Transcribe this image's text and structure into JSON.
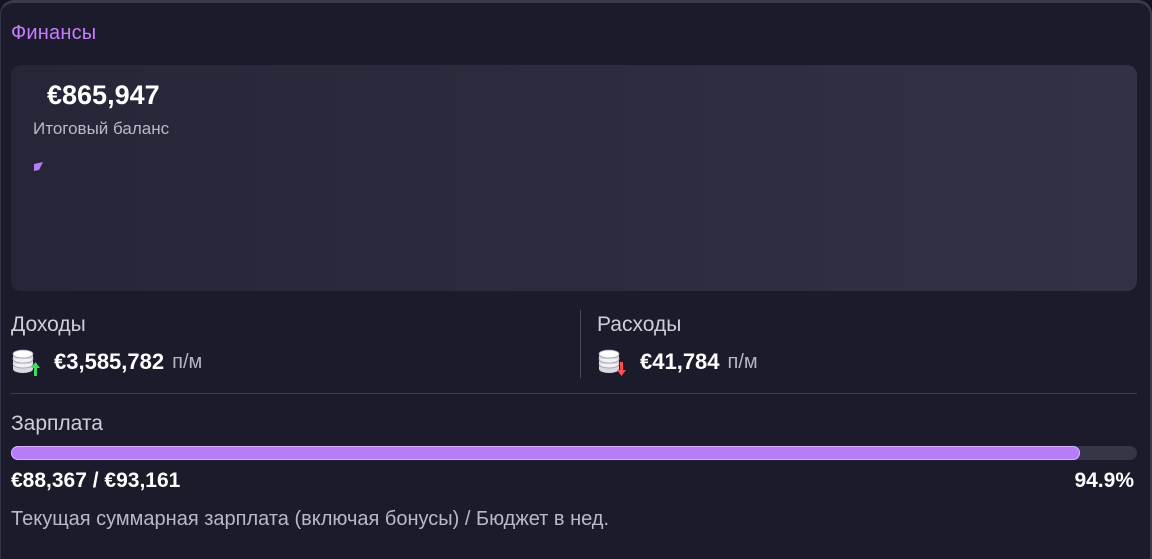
{
  "section": {
    "title": "Финансы"
  },
  "balance": {
    "value": "€865,947",
    "label": "Итоговый баланс"
  },
  "income": {
    "label": "Доходы",
    "value": "€3,585,782",
    "unit": "п/м",
    "icon": "coins-arrow-up-icon",
    "arrow_color": "#3ddc5a"
  },
  "expense": {
    "label": "Расходы",
    "value": "€41,784",
    "unit": "п/м",
    "icon": "coins-arrow-down-icon",
    "arrow_color": "#ff4d4d"
  },
  "salary": {
    "label": "Зарплата",
    "amount": "€88,367 / €93,161",
    "percent": "94.9%",
    "progress": 0.949,
    "note": "Текущая суммарная зарплата (включая бонусы) / Бюджет в нед."
  },
  "colors": {
    "accent": "#c77dff",
    "progress_fill": "#b77cf7",
    "panel_bg": "#1b1b2b"
  }
}
